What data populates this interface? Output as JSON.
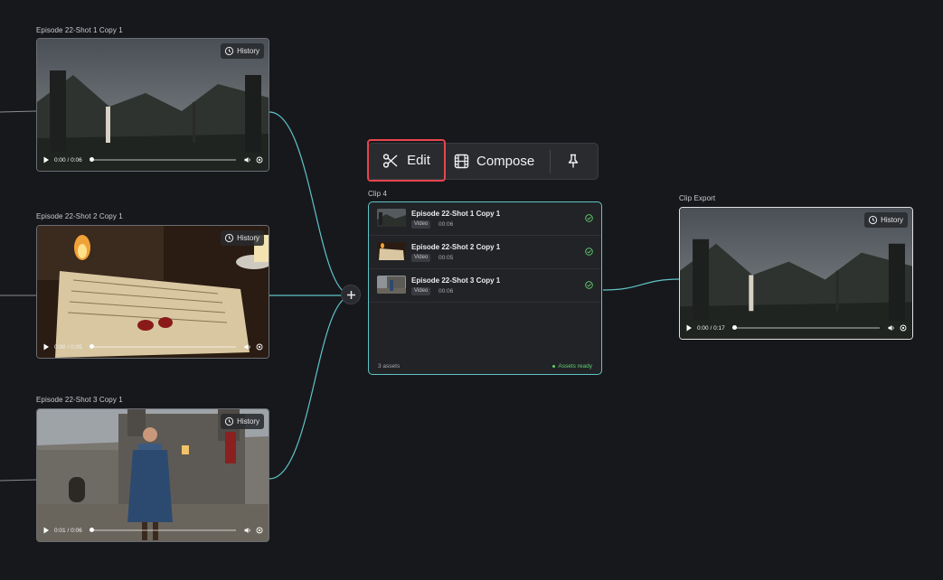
{
  "nodes": {
    "shot1": {
      "label": "Episode 22-Shot 1 Copy 1",
      "history": "History",
      "time": "0:00 / 0:06"
    },
    "shot2": {
      "label": "Episode 22-Shot 2 Copy 1",
      "history": "History",
      "time": "0:00 / 0:05"
    },
    "shot3": {
      "label": "Episode 22-Shot 3 Copy 1",
      "history": "History",
      "time": "0:01 / 0:06"
    },
    "export": {
      "label": "Clip Export",
      "history": "History",
      "time": "0:00 / 0:17"
    }
  },
  "toolbar": {
    "edit_label": "Edit",
    "compose_label": "Compose"
  },
  "clip": {
    "label": "Clip 4",
    "items": [
      {
        "title": "Episode 22-Shot 1 Copy 1",
        "type": "Video",
        "duration": "00:06"
      },
      {
        "title": "Episode 22-Shot 2 Copy 1",
        "type": "Video",
        "duration": "00:05"
      },
      {
        "title": "Episode 22-Shot 3 Copy 1",
        "type": "Video",
        "duration": "00:06"
      }
    ],
    "assets_count": "3 assets",
    "status": "Assets ready"
  },
  "colors": {
    "edge": "#5fc4c7",
    "highlight": "#e5454c",
    "ready": "#5fd16e"
  },
  "icons": [
    "history-icon",
    "play-icon",
    "volume-icon",
    "settings-icon",
    "scissors-icon",
    "film-icon",
    "pin-icon",
    "check-circle-icon",
    "plus-icon"
  ]
}
